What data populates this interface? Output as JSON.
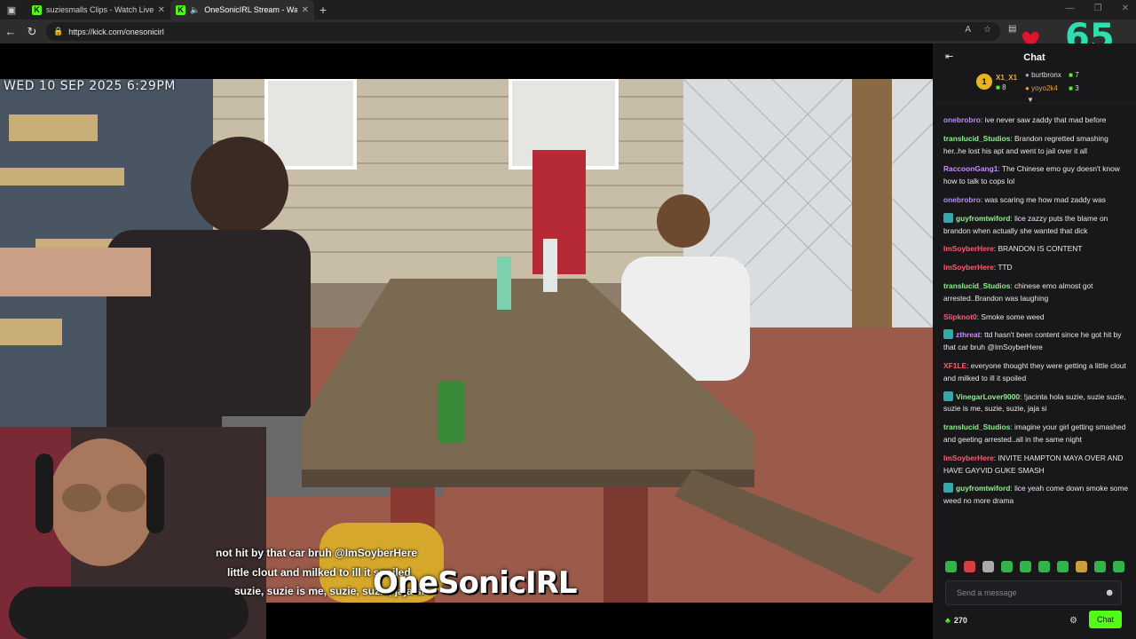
{
  "browser": {
    "tabs": [
      {
        "label": "suziesmalls Clips - Watch Live on"
      },
      {
        "label": "OneSonicIRL Stream - Watch"
      }
    ],
    "url": "https://kick.com/onesonicirl"
  },
  "viewers": "65",
  "stream": {
    "timestamp": "WED 10 SEP 2025 6:29PM",
    "overlay_lines": [
      "not hit by that car bruh @ImSoyberHere",
      "little clout and milked to ill it spoiled",
      "suzie, suzie is me, suzie, suzie, jaja si"
    ],
    "brand": "OneSonicIRL"
  },
  "chat": {
    "title": "Chat",
    "leaders": [
      {
        "rank": "1",
        "name": "X1_X1",
        "count": "8"
      },
      {
        "name": "burtbronx",
        "count": "7"
      },
      {
        "name": "yoyo2k4",
        "count": "3"
      }
    ],
    "messages": [
      {
        "user": "onebrobro",
        "text": "ive never saw zaddy that mad before",
        "color": "#b78cff",
        "badge": false
      },
      {
        "user": "translucid_Studios",
        "text": "Brandon regretted smashing her..he lost his apt and went to jail over it all",
        "color": "#8ef08e",
        "badge": false
      },
      {
        "user": "RaccoonGang1",
        "text": "The Chinese emo guy doesn't know how to talk to cops lol",
        "color": "#c98cff",
        "badge": false
      },
      {
        "user": "onebrobro",
        "text": "was scaring me how mad zaddy was",
        "color": "#b78cff",
        "badge": false
      },
      {
        "user": "guyfromtwiford",
        "text": "lice zazzy puts the blame on brandon when actually she wanted that dick",
        "color": "#8ef08e",
        "badge": true
      },
      {
        "user": "ImSoyberHere",
        "text": "BRANDON IS CONTENT",
        "color": "#ff5a6e",
        "badge": false
      },
      {
        "user": "ImSoyberHere",
        "text": "TTD",
        "color": "#ff5a6e",
        "badge": false
      },
      {
        "user": "translucid_Studios",
        "text": "chinese emo almost got arrested..Brandon was laughing",
        "color": "#8ef08e",
        "badge": false
      },
      {
        "user": "Slipknot0",
        "text": "Smoke some weed",
        "color": "#ff5a6e",
        "badge": false
      },
      {
        "user": "zthreat",
        "text": "ttd hasn't been content since he got hit by that car bruh @ImSoyberHere",
        "color": "#c98cff",
        "badge": true
      },
      {
        "user": "XF1LE",
        "text": "everyone thought they were getting a little clout and milked to ill it spoiled",
        "color": "#ff5a6e",
        "badge": false
      },
      {
        "user": "VinegarLover9000",
        "text": "!jacinta hola suzie, suzie suzie, suzie is me, suzie, suzie, jaja si",
        "color": "#8ef08e",
        "badge": true
      },
      {
        "user": "translucid_Studios",
        "text": "imagine your girl getting smashed and geeting arrested..all in the same night",
        "color": "#8ef08e",
        "badge": false
      },
      {
        "user": "ImSoyberHere",
        "text": "INVITE HAMPTON MAYA OVER AND HAVE GAYVID GUKE SMASH",
        "color": "#ff5a6e",
        "badge": false
      },
      {
        "user": "guyfromtwiford",
        "text": "lice yeah come down smoke some weed no more drama",
        "color": "#8ef08e",
        "badge": true
      }
    ],
    "input_placeholder": "Send a message",
    "points": "270",
    "chat_button": "Chat"
  }
}
